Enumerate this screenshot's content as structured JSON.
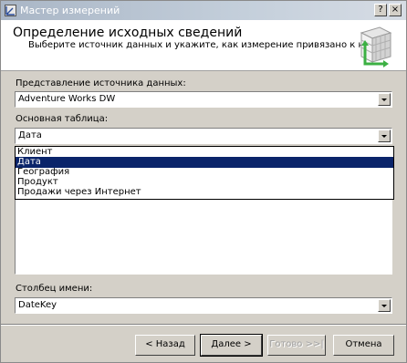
{
  "window": {
    "title": "Мастер измерений",
    "title_buttons": {
      "help": "?",
      "close": "×"
    }
  },
  "header": {
    "title": "Определение исходных сведений",
    "subtitle": "Выберите источник данных и укажите, как измерение привязано к нему."
  },
  "data_source": {
    "label": "Представление источника данных:",
    "value": "Adventure Works DW"
  },
  "main_table": {
    "label": "Основная таблица:",
    "value": "Дата",
    "options": [
      "Клиент",
      "Дата",
      "География",
      "Продукт",
      "Продажи через Интернет"
    ],
    "selected_index": 1
  },
  "name_column": {
    "label": "Столбец имени:",
    "value": "DateKey"
  },
  "buttons": {
    "back": "< Назад",
    "next": "Далее >",
    "finish": "Готово >>|",
    "cancel": "Отмена"
  },
  "colors": {
    "selection": "#0a246a",
    "face": "#d4d0c8",
    "title_gradient": "#a9b6c6"
  }
}
